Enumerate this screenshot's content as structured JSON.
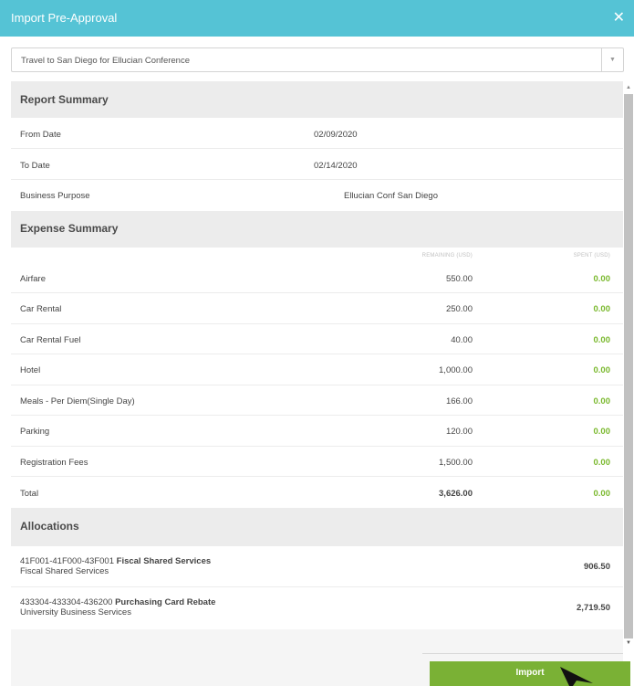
{
  "dialog": {
    "title": "Import Pre-Approval",
    "close_icon": "close-icon"
  },
  "select": {
    "value": "Travel to San Diego for Ellucian Conference",
    "arrow_icon": "chevron-down-icon"
  },
  "report_summary": {
    "heading": "Report Summary",
    "rows": [
      {
        "label": "From Date",
        "value": "02/09/2020"
      },
      {
        "label": "To Date",
        "value": "02/14/2020"
      },
      {
        "label": "Business Purpose",
        "value": "Ellucian Conf San Diego"
      }
    ]
  },
  "expense_summary": {
    "heading": "Expense Summary",
    "col_remaining": "REMAINING (USD)",
    "col_spent": "SPENT (USD)",
    "rows": [
      {
        "label": "Airfare",
        "remaining": "550.00",
        "spent": "0.00"
      },
      {
        "label": "Car Rental",
        "remaining": "250.00",
        "spent": "0.00"
      },
      {
        "label": "Car Rental Fuel",
        "remaining": "40.00",
        "spent": "0.00"
      },
      {
        "label": "Hotel",
        "remaining": "1,000.00",
        "spent": "0.00"
      },
      {
        "label": "Meals - Per Diem(Single Day)",
        "remaining": "166.00",
        "spent": "0.00"
      },
      {
        "label": "Parking",
        "remaining": "120.00",
        "spent": "0.00"
      },
      {
        "label": "Registration Fees",
        "remaining": "1,500.00",
        "spent": "0.00"
      }
    ],
    "total": {
      "label": "Total",
      "remaining": "3,626.00",
      "spent": "0.00"
    }
  },
  "allocations": {
    "heading": "Allocations",
    "rows": [
      {
        "code": "41F001-41F000-43F001",
        "name": "Fiscal Shared Services",
        "sub": "Fiscal Shared Services",
        "amount": "906.50"
      },
      {
        "code": "433304-433304-436200",
        "name": "Purchasing Card Rebate",
        "sub": "University Business Services",
        "amount": "2,719.50"
      }
    ]
  },
  "footer": {
    "import_label": "Import"
  },
  "colors": {
    "titlebar": "#55c3d5",
    "accent_green": "#7ab135",
    "spent_green": "#79b82c"
  }
}
